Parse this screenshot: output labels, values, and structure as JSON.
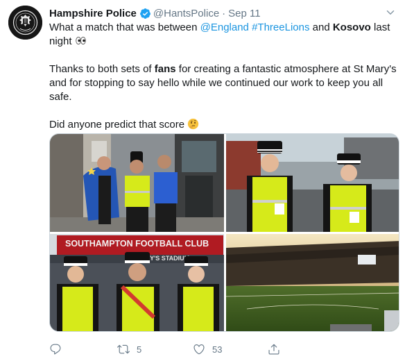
{
  "tweet": {
    "author": {
      "display_name": "Hampshire Police",
      "handle": "@HantsPolice",
      "separator": "·",
      "date": "Sep 11",
      "verified": true,
      "avatar_icon": "hampshire-police-crest-icon"
    },
    "text": {
      "p1_a": "What a match that was between ",
      "p1_mention": "@England",
      "p1_space": " ",
      "p1_hashtag": "#ThreeLions",
      "p1_b": " and ",
      "p1_bold": "Kosovo",
      "p1_c": " last night ",
      "p1_emoji": "eyes-emoji",
      "p2_a": "Thanks to both sets of ",
      "p2_bold": "fans",
      "p2_b": " for creating a fantastic atmosphere at St Mary's and for stopping to say hello while we continued our work to keep you all safe.",
      "p3_a": "Did anyone predict that score ",
      "p3_emoji": "thinking-face-emoji"
    },
    "media": {
      "photo3_sign": "SOUTHAMPTON FOOTBALL CLUB",
      "photo3_sign_sub": "ST MARY'S STADIUM"
    },
    "actions": {
      "reply_count": "",
      "retweet_count": "5",
      "like_count": "53",
      "share_count": ""
    },
    "colors": {
      "link": "#1b95e0",
      "secondary_text": "#657786",
      "verified_badge": "#1da1f2",
      "hi_vis": "#d6ea1a"
    }
  }
}
